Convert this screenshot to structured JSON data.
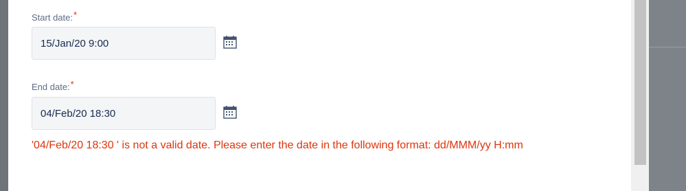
{
  "form": {
    "start": {
      "label": "Start date:",
      "required_mark": "*",
      "value": "15/Jan/20 9:00"
    },
    "end": {
      "label": "End date:",
      "required_mark": "*",
      "value": "04/Feb/20 18:30"
    },
    "error_message": "'04/Feb/20 18:30 ' is not a valid date. Please enter the date in the following format: dd/MMM/yy H:mm",
    "calendar_icon": "calendar-icon"
  },
  "colors": {
    "error": "#de350b",
    "label": "#5e6c84",
    "field_bg": "#f4f5f7"
  }
}
